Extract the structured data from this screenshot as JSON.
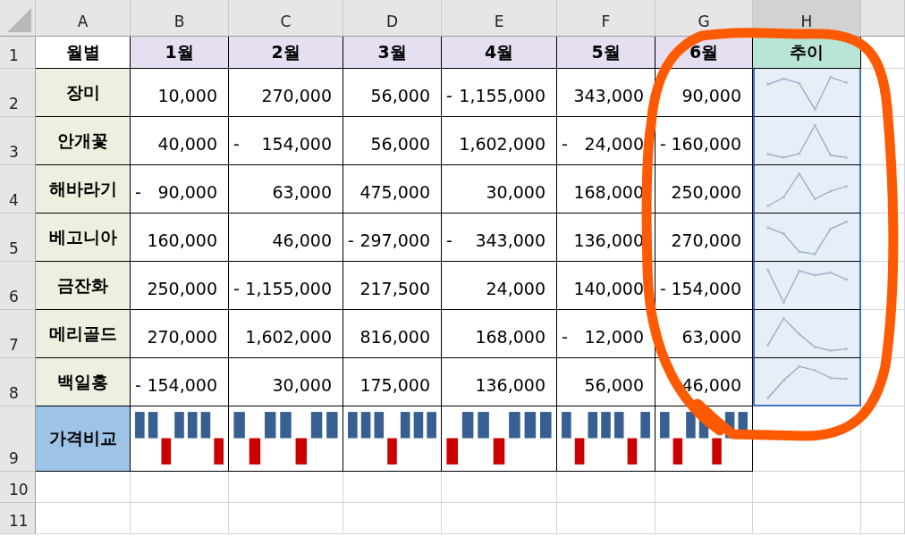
{
  "column_headers": [
    "A",
    "B",
    "C",
    "D",
    "E",
    "F",
    "G",
    "H"
  ],
  "row_numbers": [
    "1",
    "2",
    "3",
    "4",
    "5",
    "6",
    "7",
    "8",
    "9",
    "10",
    "11"
  ],
  "header": {
    "label": "월별",
    "months": [
      "1월",
      "2월",
      "3월",
      "4월",
      "5월",
      "6월"
    ],
    "trend": "추이"
  },
  "rows": [
    {
      "name": "장미",
      "values": [
        {
          "amount": "10,000"
        },
        {
          "amount": "270,000"
        },
        {
          "amount": "56,000"
        },
        {
          "sign": "-",
          "amount": "1,155,000"
        },
        {
          "amount": "343,000"
        },
        {
          "amount": "90,000"
        }
      ]
    },
    {
      "name": "안개꽃",
      "values": [
        {
          "amount": "40,000"
        },
        {
          "sign": "-",
          "amount": "154,000"
        },
        {
          "amount": "56,000"
        },
        {
          "amount": "1,602,000"
        },
        {
          "sign": "-",
          "amount": "24,000"
        },
        {
          "sign": "-",
          "amount": "160,000"
        }
      ]
    },
    {
      "name": "해바라기",
      "values": [
        {
          "sign": "-",
          "amount": "90,000"
        },
        {
          "amount": "63,000"
        },
        {
          "amount": "475,000"
        },
        {
          "amount": "30,000"
        },
        {
          "amount": "168,000"
        },
        {
          "amount": "250,000"
        }
      ]
    },
    {
      "name": "베고니아",
      "values": [
        {
          "amount": "160,000"
        },
        {
          "amount": "46,000"
        },
        {
          "sign": "-",
          "amount": "297,000"
        },
        {
          "sign": "-",
          "amount": "343,000"
        },
        {
          "amount": "136,000"
        },
        {
          "amount": "270,000"
        }
      ]
    },
    {
      "name": "금잔화",
      "values": [
        {
          "amount": "250,000"
        },
        {
          "sign": "-",
          "amount": "1,155,000"
        },
        {
          "amount": "217,500"
        },
        {
          "amount": "24,000"
        },
        {
          "amount": "140,000"
        },
        {
          "sign": "-",
          "amount": "154,000"
        }
      ]
    },
    {
      "name": "메리골드",
      "values": [
        {
          "amount": "270,000"
        },
        {
          "amount": "1,602,000"
        },
        {
          "amount": "816,000"
        },
        {
          "amount": "168,000"
        },
        {
          "sign": "-",
          "amount": "12,000"
        },
        {
          "amount": "63,000"
        }
      ]
    },
    {
      "name": "백일홍",
      "values": [
        {
          "sign": "-",
          "amount": "154,000"
        },
        {
          "amount": "30,000"
        },
        {
          "amount": "175,000"
        },
        {
          "amount": "136,000"
        },
        {
          "amount": "56,000"
        },
        {
          "amount": "46,000"
        }
      ]
    }
  ],
  "summary_row": {
    "label": "가격비교"
  }
}
